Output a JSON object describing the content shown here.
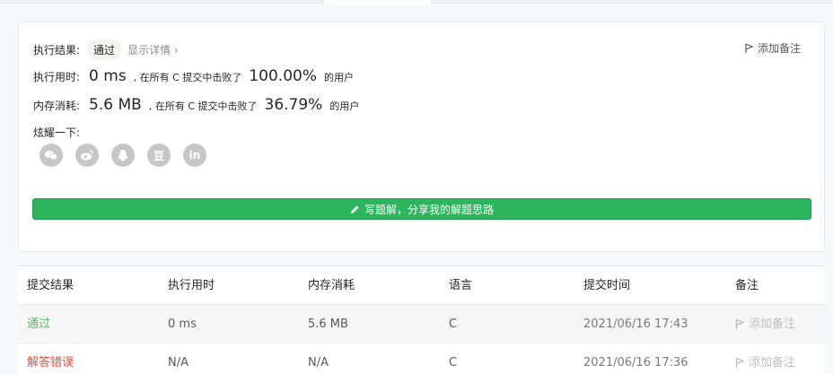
{
  "result": {
    "label": "执行结果:",
    "status": "通过",
    "detail_link": "显示详情 ›",
    "add_note": "添加备注"
  },
  "time_row": {
    "label": "执行用时:",
    "value": "0 ms",
    "mid": ", 在所有 C 提交中击败了",
    "percent": "100.00%",
    "suffix": "的用户"
  },
  "mem_row": {
    "label": "内存消耗:",
    "value": "5.6 MB",
    "mid": ", 在所有 C 提交中击败了",
    "percent": "36.79%",
    "suffix": "的用户"
  },
  "share": {
    "label": "炫耀一下:",
    "buttons": [
      "wechat-icon",
      "weibo-icon",
      "qq-icon",
      "douban-icon",
      "linkedin-icon"
    ],
    "douban_glyph": "豆",
    "linkedin_glyph": "in"
  },
  "write_button": "写题解，分享我的解题思路",
  "table": {
    "headers": [
      "提交结果",
      "执行用时",
      "内存消耗",
      "语言",
      "提交时间",
      "备注"
    ],
    "rows": [
      {
        "status": "通过",
        "time": "0 ms",
        "memory": "5.6 MB",
        "lang": "C",
        "submitted": "2021/06/16 17:43",
        "note": "添加备注"
      },
      {
        "status": "解答错误",
        "time": "N/A",
        "memory": "N/A",
        "lang": "C",
        "submitted": "2021/06/16 17:36",
        "note": "添加备注"
      }
    ]
  },
  "colors": {
    "accent_green": "#2db55d",
    "pass_green": "#5cb85c",
    "error_red": "#e74c3c"
  }
}
